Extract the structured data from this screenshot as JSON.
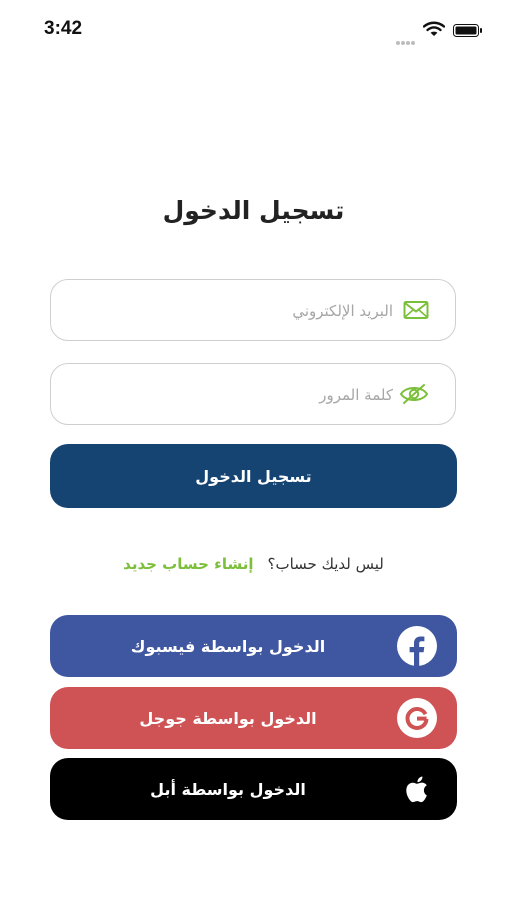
{
  "status_bar": {
    "time": "3:42"
  },
  "title": "تسجيل الدخول",
  "email": {
    "placeholder": "البريد الإلكتروني",
    "value": ""
  },
  "password": {
    "placeholder": "كلمة المرور",
    "value": ""
  },
  "login_button": "تسجيل الدخول",
  "signup": {
    "question": "ليس لديك حساب؟",
    "link": "إنشاء حساب جديد"
  },
  "social": {
    "facebook": "الدخول بواسطة فيسبوك",
    "google": "الدخول بواسطة جوجل",
    "apple": "الدخول بواسطة أبل"
  },
  "icons": {
    "email": "envelope-icon",
    "password": "eye-icon",
    "facebook": "facebook-icon",
    "google": "google-icon",
    "apple": "apple-icon"
  },
  "colors": {
    "primary": "#154372",
    "accent_green": "#7cbf3a",
    "facebook": "#3f56a0",
    "google": "#cf5254",
    "apple": "#000000"
  }
}
